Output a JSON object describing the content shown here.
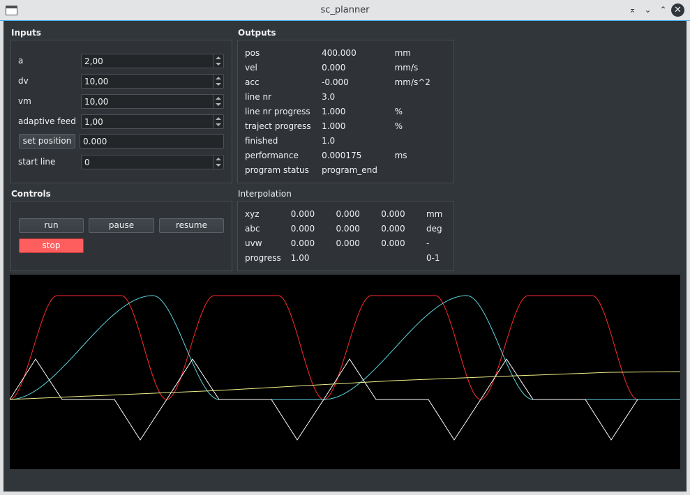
{
  "window": {
    "title": "sc_planner"
  },
  "inputs": {
    "title": "Inputs",
    "a": {
      "label": "a",
      "value": "2,00"
    },
    "dv": {
      "label": "dv",
      "value": "10,00"
    },
    "vm": {
      "label": "vm",
      "value": "10,00"
    },
    "adaptive_feed": {
      "label": "adaptive feed",
      "value": "1,00"
    },
    "set_position": {
      "button": "set position",
      "value": "0.000"
    },
    "start_line": {
      "label": "start line",
      "value": "0"
    }
  },
  "controls": {
    "title": "Controls",
    "run": "run",
    "pause": "pause",
    "resume": "resume",
    "stop": "stop",
    "stop_color": "#ff5e5e"
  },
  "outputs": {
    "title": "Outputs",
    "rows": [
      {
        "label": "pos",
        "value": "400.000",
        "unit": "mm"
      },
      {
        "label": "vel",
        "value": "0.000",
        "unit": "mm/s"
      },
      {
        "label": "acc",
        "value": "-0.000",
        "unit": "mm/s^2"
      },
      {
        "label": "line nr",
        "value": "3.0",
        "unit": ""
      },
      {
        "label": "line nr progress",
        "value": "1.000",
        "unit": "%"
      },
      {
        "label": "traject progress",
        "value": "1.000",
        "unit": "%"
      },
      {
        "label": "finished",
        "value": "1.0",
        "unit": ""
      },
      {
        "label": "performance",
        "value": "0.000175",
        "unit": "ms"
      },
      {
        "label": "program status",
        "value": "program_end",
        "unit": ""
      }
    ]
  },
  "interpolation": {
    "title": "Interpolation",
    "rows": [
      {
        "label": "xyz",
        "v1": "0.000",
        "v2": "0.000",
        "v3": "0.000",
        "unit": "mm"
      },
      {
        "label": "abc",
        "v1": "0.000",
        "v2": "0.000",
        "v3": "0.000",
        "unit": "deg"
      },
      {
        "label": "uvw",
        "v1": "0.000",
        "v2": "0.000",
        "v3": "0.000",
        "unit": "-"
      },
      {
        "label": "progress",
        "v1": "1.00",
        "v2": "",
        "v3": "",
        "unit": "0-1"
      }
    ]
  },
  "chart_data": {
    "type": "line",
    "background": "#000000",
    "series": [
      {
        "color": "#ff2a2a",
        "shape": "trapezoid-pulses"
      },
      {
        "color": "#5fd7e0",
        "shape": "s-curve-up-down"
      },
      {
        "color": "#ffffff",
        "shape": "triangle-acceleration"
      },
      {
        "color": "#f0f08a",
        "shape": "linear-ramp"
      }
    ]
  }
}
